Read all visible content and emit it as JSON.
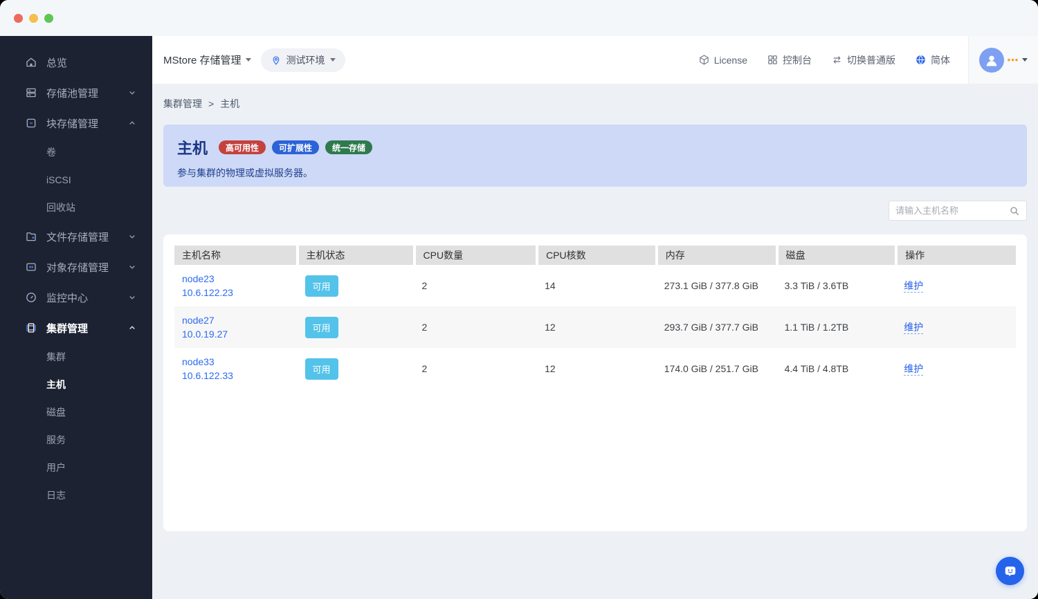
{
  "window": {
    "controls": [
      "close",
      "minimize",
      "maximize"
    ]
  },
  "header": {
    "app_title": "MStore 存储管理",
    "environment": "测试环境",
    "license_label": "License",
    "console_label": "控制台",
    "switch_edition_label": "切换普通版",
    "language_label": "简体",
    "avatar_dots": "•••"
  },
  "sidebar": {
    "items": [
      {
        "label": "总览",
        "icon": "home-icon"
      },
      {
        "label": "存储池管理",
        "icon": "storage-pool-icon",
        "chevron": "down"
      },
      {
        "label": "块存储管理",
        "icon": "block-storage-icon",
        "chevron": "up",
        "children": [
          "卷",
          "iSCSI",
          "回收站"
        ]
      },
      {
        "label": "文件存储管理",
        "icon": "file-storage-icon",
        "chevron": "down"
      },
      {
        "label": "对象存储管理",
        "icon": "object-storage-icon",
        "chevron": "down"
      },
      {
        "label": "监控中心",
        "icon": "monitor-icon",
        "chevron": "down"
      },
      {
        "label": "集群管理",
        "icon": "cluster-icon",
        "chevron": "up",
        "active": true,
        "children": [
          "集群",
          "主机",
          "磁盘",
          "服务",
          "用户",
          "日志"
        ],
        "active_child": "主机"
      }
    ]
  },
  "breadcrumb": {
    "parent": "集群管理",
    "separator": ">",
    "current": "主机"
  },
  "banner": {
    "title": "主机",
    "badges": [
      {
        "label": "高可用性",
        "color": "#c5413e"
      },
      {
        "label": "可扩展性",
        "color": "#2c63d6"
      },
      {
        "label": "统一存储",
        "color": "#2e7a4d"
      }
    ],
    "description": "参与集群的物理或虚拟服务器。"
  },
  "search": {
    "placeholder": "请输入主机名称"
  },
  "table": {
    "columns": [
      "主机名称",
      "主机状态",
      "CPU数量",
      "CPU核数",
      "内存",
      "磁盘",
      "操作"
    ],
    "rows": [
      {
        "name": "node23",
        "ip": "10.6.122.23",
        "status": "可用",
        "cpu_count": "2",
        "cpu_cores": "14",
        "memory": "273.1 GiB / 377.8 GiB",
        "disk": "3.3 TiB / 3.6TB",
        "action": "维护"
      },
      {
        "name": "node27",
        "ip": "10.0.19.27",
        "status": "可用",
        "cpu_count": "2",
        "cpu_cores": "12",
        "memory": "293.7 GiB / 377.7 GiB",
        "disk": "1.1 TiB / 1.2TB",
        "action": "维护"
      },
      {
        "name": "node33",
        "ip": "10.6.122.33",
        "status": "可用",
        "cpu_count": "2",
        "cpu_cores": "12",
        "memory": "174.0 GiB / 251.7 GiB",
        "disk": "4.4 TiB / 4.8TB",
        "action": "维护"
      }
    ]
  },
  "colors": {
    "sidebar_bg": "#1c2231",
    "accent_blue": "#2a6af2",
    "status_badge_bg": "#54c3ea",
    "banner_bg": "#cdd9f6",
    "banner_text": "#1c3586",
    "content_bg": "#edf1f6",
    "table_header_bg": "#e0e0e0",
    "avatar_bg": "#7ea0f3",
    "chat_fab_bg": "#2563eb",
    "traffic_lights": [
      "#ed6a5e",
      "#f5bf4f",
      "#61c554"
    ]
  }
}
